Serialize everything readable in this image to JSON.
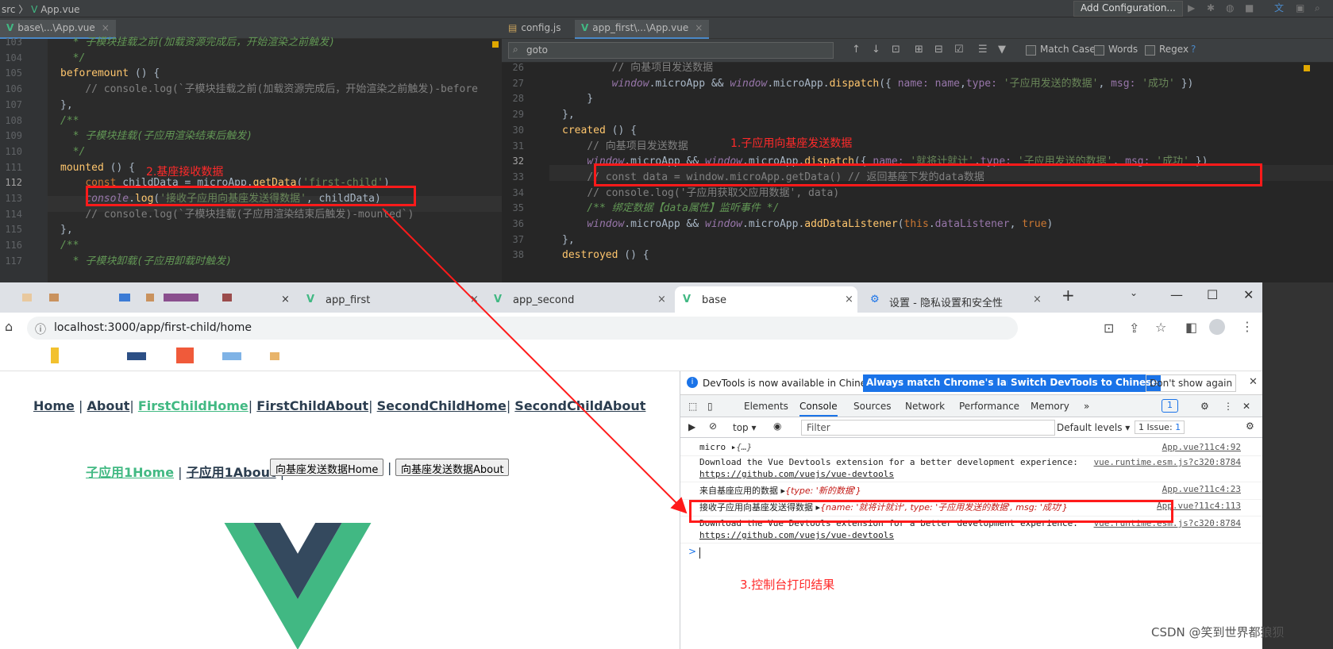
{
  "ide": {
    "breadcrumb": [
      "src",
      "App.vue"
    ],
    "add_configuration": "Add Configuration...",
    "left_tab": "base\\...\\App.vue",
    "right_tabs": [
      {
        "label": "config.js"
      },
      {
        "label": "app_first\\...\\App.vue"
      }
    ],
    "find": {
      "query": "goto",
      "match_case": "Match Case",
      "words": "Words",
      "regex": "Regex",
      "help": "?"
    },
    "left_lines": [
      {
        "n": "103",
        "text": "  * 子模块挂载之前(加载资源完成后，开始渲染之前触发)"
      },
      {
        "n": "104",
        "text": "  */"
      },
      {
        "n": "105",
        "text": "beforemount () {"
      },
      {
        "n": "106",
        "text": "    // console.log(`子模块挂载之前(加载资源完成后，开始渲染之前触发)-before"
      },
      {
        "n": "107",
        "text": "},"
      },
      {
        "n": "108",
        "text": "/**"
      },
      {
        "n": "109",
        "text": "  * 子模块挂载(子应用渲染结束后触发)"
      },
      {
        "n": "110",
        "text": "  */"
      },
      {
        "n": "111",
        "text": "mounted () {"
      },
      {
        "n": "112",
        "text": "    const childData = microApp.getData('first-child')"
      },
      {
        "n": "113",
        "text": "    console.log('接收子应用向基座发送得数据', childData)"
      },
      {
        "n": "114",
        "text": "    // console.log(`子模块挂载(子应用渲染结束后触发)-mounted`)"
      },
      {
        "n": "115",
        "text": "},"
      },
      {
        "n": "116",
        "text": "/**"
      },
      {
        "n": "117",
        "text": "  * 子模块卸载(子应用卸载时触发)"
      }
    ],
    "right_lines": [
      {
        "n": "26",
        "text": "        // 向基项目发送数据"
      },
      {
        "n": "27",
        "text": "        window.microApp && window.microApp.dispatch({ name: name,type: '子应用发送的数据', msg: '成功' })"
      },
      {
        "n": "28",
        "text": "    }"
      },
      {
        "n": "29",
        "text": "},"
      },
      {
        "n": "30",
        "text": "created () {"
      },
      {
        "n": "31",
        "text": "    // 向基项目发送数据"
      },
      {
        "n": "32",
        "text": "    window.microApp && window.microApp.dispatch({ name: '就将计就计',type: '子应用发送的数据', msg: '成功' })"
      },
      {
        "n": "33",
        "text": "    // const data = window.microApp.getData() // 返回基座下发的data数据"
      },
      {
        "n": "34",
        "text": "    // console.log('子应用获取父应用数据', data)"
      },
      {
        "n": "35",
        "text": "    /** 绑定数据【data属性】监听事件 */"
      },
      {
        "n": "36",
        "text": "    window.microApp && window.microApp.addDataListener(this.dataListener, true)"
      },
      {
        "n": "37",
        "text": "},"
      },
      {
        "n": "38",
        "text": "destroyed () {"
      }
    ]
  },
  "annotations": {
    "a1": "1.子应用向基座发送数据",
    "a2": "2.基座接收数据",
    "a3": "3.控制台打印结果"
  },
  "browser": {
    "tabs": [
      {
        "label": "app_first"
      },
      {
        "label": "app_second"
      },
      {
        "label": "base"
      },
      {
        "label": "设置 - 隐私设置和安全性"
      }
    ],
    "new_tab": "+",
    "url": "localhost:3000/app/first-child/home",
    "nav1": {
      "home": "Home",
      "about": "About",
      "fch": "FirstChildHome",
      "fca": "FirstChildAbout",
      "sch": "SecondChildHome",
      "sca": "SecondChildAbout",
      "sep": "|"
    },
    "nav2": {
      "a": "子应用1Home",
      "b": "子应用1About",
      "btn1": "向基座发送数据Home",
      "btn2": "向基座发送数据About",
      "sep": "|"
    }
  },
  "devtools": {
    "info": "DevTools is now available in Chinese!",
    "btn_match": "Always match Chrome's language",
    "btn_switch": "Switch DevTools to Chinese",
    "btn_dont": "Don't show again",
    "tabs": [
      "Elements",
      "Console",
      "Sources",
      "Network",
      "Performance",
      "Memory"
    ],
    "more": "»",
    "badge": "1",
    "context": "top ▾",
    "filter_placeholder": "Filter",
    "levels": "Default levels ▾",
    "issues": "1 Issue:",
    "issues_count": "1",
    "logs": [
      {
        "msg": "micro",
        "obj": "{…}",
        "src": "App.vue?11c4:92"
      },
      {
        "msg": "Download the Vue Devtools extension for a better development experience:",
        "link": "https://github.com/vuejs/vue-devtools",
        "src": "vue.runtime.esm.js?c320:8784"
      },
      {
        "msg": "来自基座应用的数据",
        "obj": "{type: '新的数据'}",
        "src": "App.vue?11c4:23"
      },
      {
        "msg": "接收子应用向基座发送得数据",
        "obj": "{name: '就将计就计', type: '子应用发送的数据', msg: '成功'}",
        "src": "App.vue?11c4:113"
      },
      {
        "msg": "Download the Vue Devtools extension for a better development experience:",
        "link": "https://github.com/vuejs/vue-devtools",
        "src": "vue.runtime.esm.js?c320:8784"
      }
    ],
    "prompt": ">"
  },
  "watermark": "CSDN @笑到世界都狼狈",
  "colors": {
    "vue_green": "#41b883",
    "vue_dark": "#34495e",
    "annotation_red": "#ff1a1a",
    "chrome_blue": "#1a73e8"
  }
}
